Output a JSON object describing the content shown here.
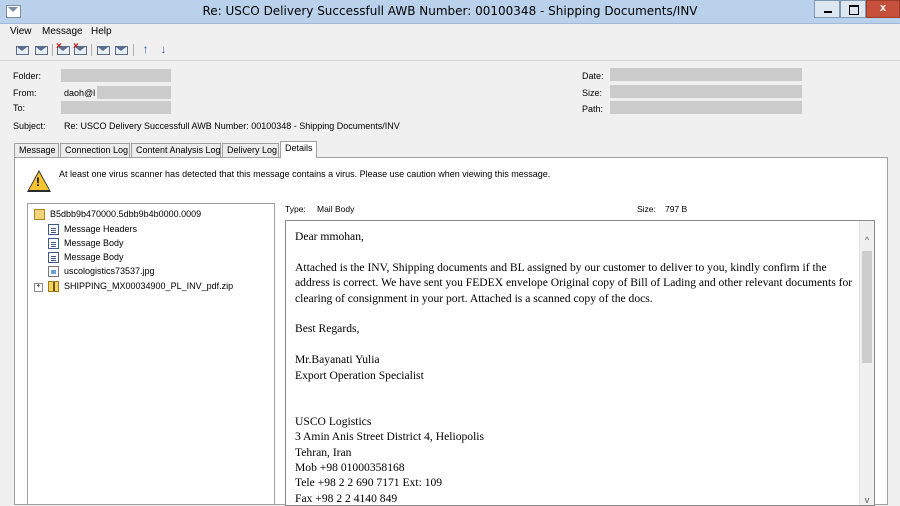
{
  "window": {
    "title": "Re: USCO Delivery Successfull AWB Number: 00100348 - Shipping Documents/INV",
    "close_label": "x"
  },
  "menu": [
    "View",
    "Message",
    "Help"
  ],
  "toolbar": {
    "icons": [
      "envelope-icon",
      "envelope-reply-icon",
      "red-x-envelope-icon",
      "red-x-envelope-icon",
      "forward-envelope-icon",
      "forward-envelope-icon",
      "arrow-up-icon",
      "arrow-down-icon"
    ],
    "up_glyph": "↑",
    "down_glyph": "↓"
  },
  "header": {
    "folder_label": "Folder:",
    "from_label": "From:",
    "from_value": "daoh@l",
    "to_label": "To:",
    "subject_label": "Subject:",
    "subject_value": "Re: USCO Delivery Successfull AWB Number: 00100348 - Shipping Documents/INV",
    "date_label": "Date:",
    "size_label": "Size:",
    "path_label": "Path:"
  },
  "tabs": [
    {
      "label": "Message",
      "active": false
    },
    {
      "label": "Connection Log",
      "active": false
    },
    {
      "label": "Content Analysis Log",
      "active": false
    },
    {
      "label": "Delivery Log",
      "active": false
    },
    {
      "label": "Details",
      "active": true
    }
  ],
  "warning": "At least one virus scanner has detected that this message contains a virus. Please use caution when viewing this message.",
  "tree": {
    "root": "B5dbb9b470000.5dbb9b4b0000.0009",
    "children": [
      {
        "label": "Message Headers",
        "icon": "document-icon"
      },
      {
        "label": "Message Body",
        "icon": "document-icon"
      },
      {
        "label": "Message Body",
        "icon": "document-icon"
      },
      {
        "label": "uscologistics73537.jpg",
        "icon": "image-icon"
      },
      {
        "label": "SHIPPING_MX00034900_PL_INV_pdf.zip",
        "icon": "zip-icon",
        "expander": "+"
      }
    ]
  },
  "details": {
    "type_label": "Type:",
    "type_value": "Mail Body",
    "size_label": "Size:",
    "size_value": "797 B"
  },
  "body": {
    "greeting": "Dear mmohan,",
    "paragraph": "Attached is the INV, Shipping documents and BL assigned by our customer to deliver to you, kindly confirm if the address is correct. We have sent you FEDEX envelope Original copy of Bill of Lading and other relevant documents for clearing of consignment in your port. Attached is a scanned copy of the docs.",
    "closing": "Best Regards,",
    "sender_name": "Mr.Bayanati Yulia",
    "sender_title": "Export Operation Specialist",
    "company": "USCO Logistics",
    "address1": "3 Amin Anis Street District 4, Heliopolis",
    "address2": "Tehran, Iran",
    "mob": "Mob +98 01000358168",
    "tele": "Tele +98 2 2 690 7171 Ext: 109",
    "fax": "Fax +98 2 2 4140 849"
  },
  "scrollbar": {
    "up_glyph": "^",
    "down_glyph": "v"
  }
}
